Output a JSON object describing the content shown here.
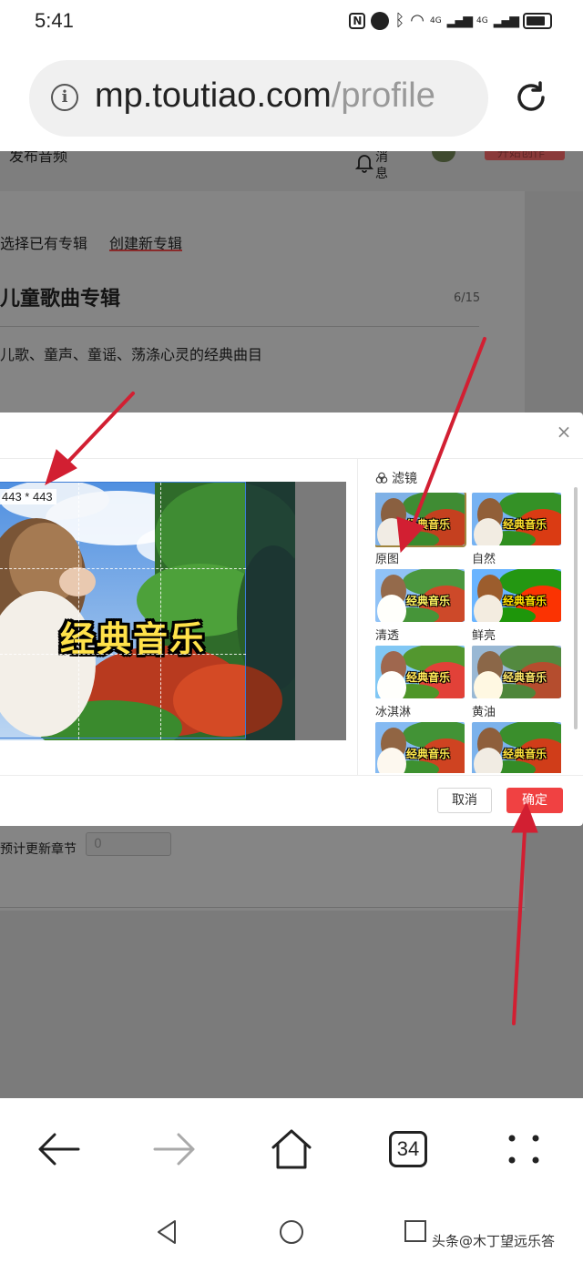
{
  "status_bar": {
    "time": "5:41",
    "icons": [
      "nfc-icon",
      "alarm-icon",
      "bluetooth-icon",
      "wifi-icon",
      "signal-4g-icon",
      "signal-4g-icon",
      "battery-icon"
    ],
    "net1": "4G",
    "net2": "4G"
  },
  "address_bar": {
    "host": "mp.toutiao.com",
    "path": "/profile"
  },
  "page": {
    "header_left": "发布音频",
    "notify_label_1": "消",
    "notify_label_2": "息",
    "start_button": "开始创作",
    "tab_existing": "选择已有专辑",
    "tab_new": "创建新专辑",
    "album_title": "儿童歌曲专辑",
    "title_count": "6/15",
    "album_desc": "儿歌、童声、童谣、荡涤心灵的经典曲目",
    "expected_chapters_label": "预计更新章节",
    "expected_chapters_value": "0"
  },
  "modal": {
    "crop_size": "443 * 443",
    "image_caption": "经典音乐",
    "filter_header": "滤镜",
    "filters": [
      {
        "label": "原图",
        "selected": true
      },
      {
        "label": "自然",
        "selected": false
      },
      {
        "label": "清透",
        "selected": false
      },
      {
        "label": "鲜亮",
        "selected": false
      },
      {
        "label": "冰淇淋",
        "selected": false
      },
      {
        "label": "黄油",
        "selected": false
      },
      {
        "label": "",
        "selected": false
      },
      {
        "label": "",
        "selected": false
      }
    ],
    "cancel": "取消",
    "confirm": "确定"
  },
  "browser_nav": {
    "tab_count": "34"
  },
  "watermark": "头条@木丁望远乐答",
  "colors": {
    "accent_red": "#f04142",
    "arrow_red": "#d21f32",
    "crop_border": "#3a7bd5",
    "dim_overlay": "#7b7b7b"
  }
}
